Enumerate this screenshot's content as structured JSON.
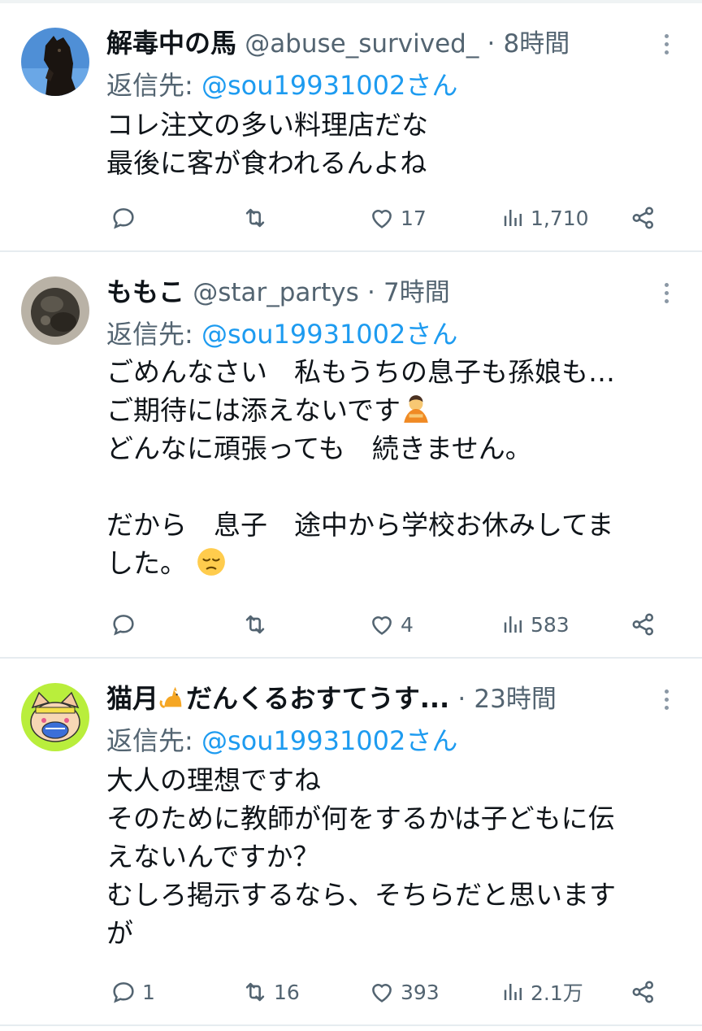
{
  "tweets": [
    {
      "display_name": "解毒中の馬",
      "handle": "@abuse_survived_",
      "time": "8時間",
      "reply_prefix": "返信先:",
      "reply_to": "@sou19931002さん",
      "lines": [
        "コレ注文の多い料理店だな",
        "最後に客が食われるんよね"
      ],
      "avatar_icon": "horse-photo-avatar",
      "actions": {
        "reply": "",
        "retweet": "",
        "like": "17",
        "views": "1,710"
      }
    },
    {
      "display_name": "ももこ",
      "handle": "@star_partys",
      "time": "7時間",
      "reply_prefix": "返信先:",
      "reply_to": "@sou19931002さん",
      "lines": [
        "ごめんなさい　私もうちの息子も孫娘も…",
        "ご期待には添えないです",
        "どんなに頑張っても　続きません。",
        "",
        "だから　息子　途中から学校お休みしてま",
        "した。"
      ],
      "emoji": [
        "person-bowing-emoji",
        "pensive-face-emoji"
      ],
      "avatar_icon": "dark-photo-avatar",
      "actions": {
        "reply": "",
        "retweet": "",
        "like": "4",
        "views": "583"
      }
    },
    {
      "display_name": "猫月",
      "display_name_rest": "だんくるおすてうす...",
      "handle": "",
      "time": "23時間",
      "reply_prefix": "返信先:",
      "reply_to": "@sou19931002さん",
      "lines": [
        "大人の理想ですね",
        "そのために教師が何をするかは子どもに伝",
        "えないんですか？",
        "むしろ掲示するなら、そちらだと思います",
        "が"
      ],
      "emoji": [
        "cat-emoji"
      ],
      "avatar_icon": "cartoon-cat-avatar",
      "actions": {
        "reply": "1",
        "retweet": "16",
        "like": "393",
        "views": "2.1万"
      }
    }
  ],
  "colors": {
    "text": "#0f1419",
    "secondary": "#536471",
    "link": "#1d9bf0",
    "divider": "#e6ecf0"
  }
}
